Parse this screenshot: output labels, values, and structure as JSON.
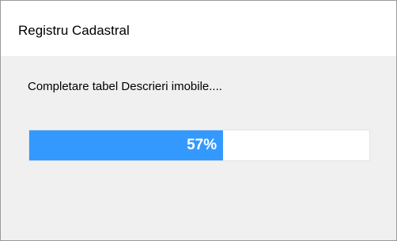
{
  "window": {
    "title": "Registru Cadastral"
  },
  "dialog": {
    "message": "Completare tabel Descrieri imobile....",
    "progress": {
      "percent": 57,
      "label": "57%",
      "fill_color": "#3399ff",
      "track_color": "#ffffff"
    }
  }
}
